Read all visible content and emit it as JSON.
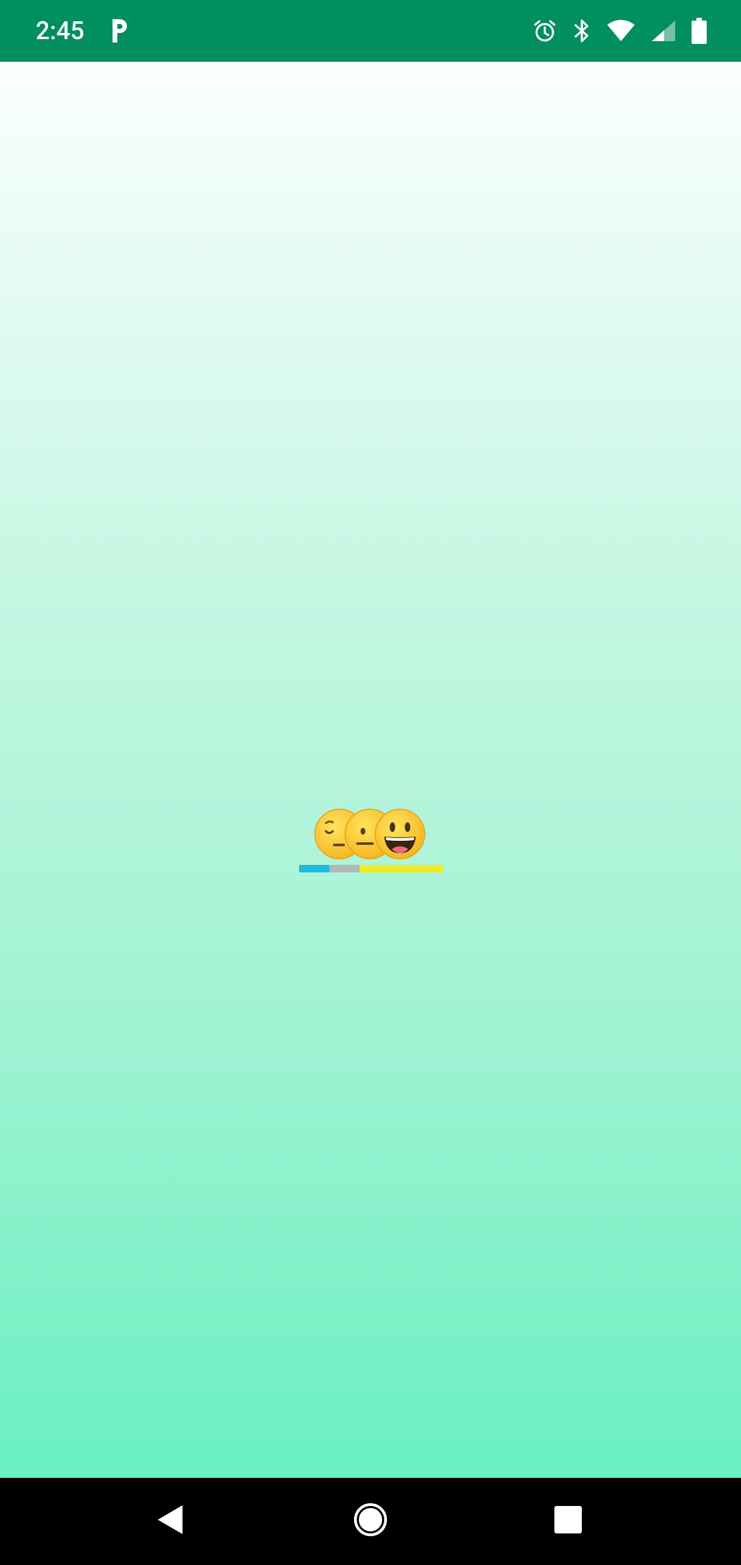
{
  "status_bar": {
    "time": "2:45",
    "background": "#008f5d",
    "icons": [
      "parking-p-icon",
      "alarm-icon",
      "bluetooth-icon",
      "wifi-icon",
      "cell-signal-icon",
      "battery-icon"
    ]
  },
  "main": {
    "background_gradient": [
      "#fbfffd",
      "#c8f7e4",
      "#9df2d2",
      "#68f0c0"
    ],
    "mood": {
      "emojis": [
        "sad-face-icon",
        "neutral-face-icon",
        "grinning-face-icon"
      ],
      "distribution": [
        {
          "label": "sad",
          "color": "#1fb8df",
          "fraction": 0.21
        },
        {
          "label": "neutral",
          "color": "#b2b6b8",
          "fraction": 0.21
        },
        {
          "label": "happy",
          "color": "#f2ea22",
          "fraction": 0.58
        }
      ]
    }
  },
  "nav_bar": {
    "background": "#000000",
    "buttons": [
      "back-icon",
      "home-icon",
      "recents-icon"
    ]
  }
}
